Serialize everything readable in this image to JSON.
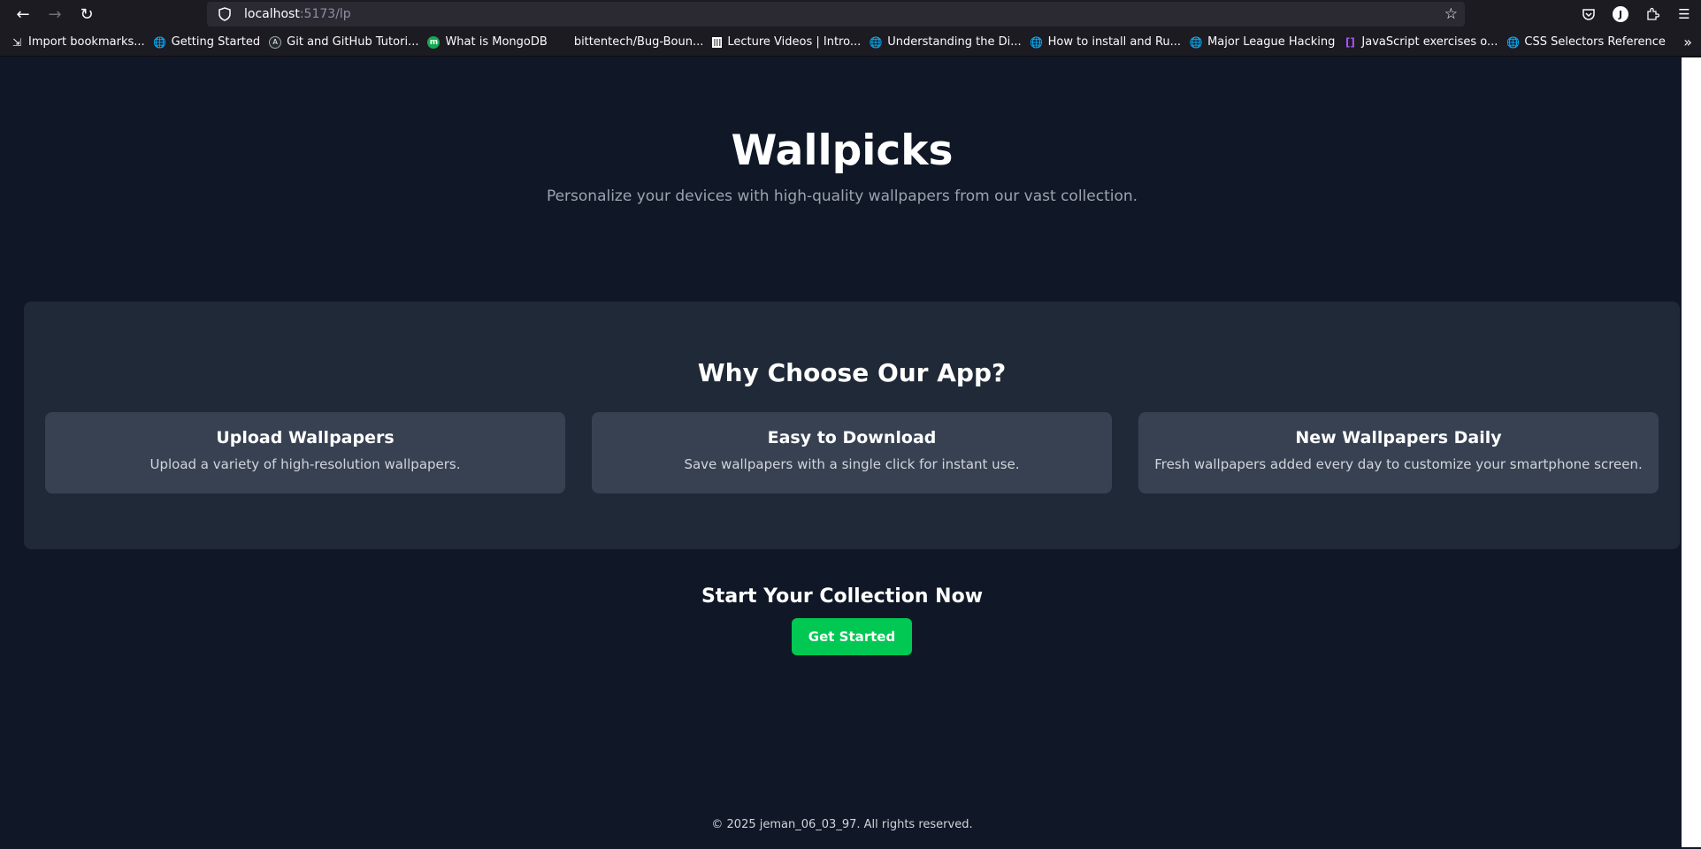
{
  "browser": {
    "url_host": "localhost",
    "url_rest": ":5173/lp",
    "bookmarks": [
      {
        "label": "Import bookmarks...",
        "icon": "import-icon"
      },
      {
        "label": "Getting Started",
        "icon": "globe-icon"
      },
      {
        "label": "Git and GitHub Tutori...",
        "icon": "git-icon"
      },
      {
        "label": "What is MongoDB",
        "icon": "mongodb-icon"
      },
      {
        "label": "bittentech/Bug-Boun...",
        "icon": "github-icon"
      },
      {
        "label": "Lecture Videos | Intro...",
        "icon": "mit-icon"
      },
      {
        "label": "Understanding the Di...",
        "icon": "globe-icon"
      },
      {
        "label": "How to install and Ru...",
        "icon": "globe-icon"
      },
      {
        "label": "Major League Hacking",
        "icon": "globe-icon"
      },
      {
        "label": "JavaScript exercises o...",
        "icon": "js-icon"
      },
      {
        "label": "CSS Selectors Reference",
        "icon": "globe-icon"
      }
    ],
    "profile_initial": "J"
  },
  "hero": {
    "title": "Wallpicks",
    "subtitle": "Personalize your devices with high-quality wallpapers from our vast collection."
  },
  "features": {
    "title": "Why Choose Our App?",
    "cards": [
      {
        "title": "Upload Wallpapers",
        "text": "Upload a variety of high-resolution wallpapers."
      },
      {
        "title": "Easy to Download",
        "text": "Save wallpapers with a single click for instant use."
      },
      {
        "title": "New Wallpapers Daily",
        "text": "Fresh wallpapers added every day to customize your smartphone screen."
      }
    ]
  },
  "cta": {
    "title": "Start Your Collection Now",
    "button": "Get Started"
  },
  "footer": {
    "text": "© 2025 jeman_06_03_97. All rights reserved."
  },
  "colors": {
    "page_bg": "#101827",
    "panel_bg": "#1f2937",
    "card_bg": "#374151",
    "accent": "#00c853"
  }
}
